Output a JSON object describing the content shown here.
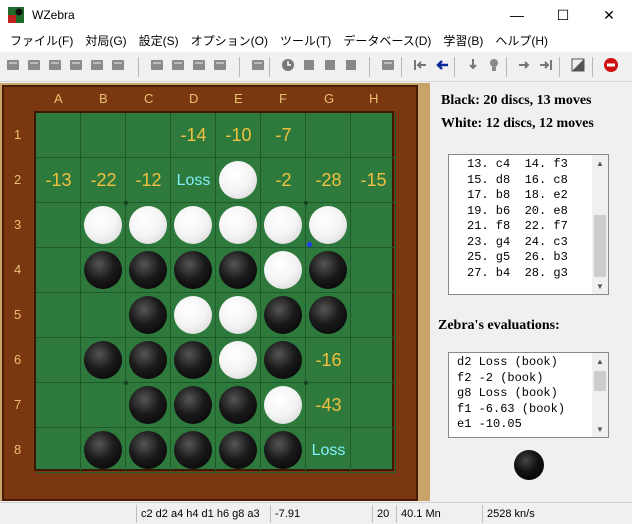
{
  "window": {
    "title": "WZebra",
    "minimize": "—",
    "maximize": "☐",
    "close": "✕"
  },
  "menu": [
    "ファイル(F)",
    "対局(G)",
    "設定(S)",
    "オプション(O)",
    "ツール(T)",
    "データベース(D)",
    "学習(B)",
    "ヘルプ(H)"
  ],
  "toolbar": [
    "new-board-icon",
    "open-icon",
    "save-icon",
    "print-icon",
    "copy-icon",
    "folder-icon",
    "export-icon",
    "book-icon",
    "book-edit-icon",
    "database-icon",
    "learn-icon",
    "clock-icon",
    "stop-icon",
    "pause-icon",
    "resign-icon",
    "step-icon",
    "undo-to-start-icon",
    "undo-icon",
    "redo-drop-icon",
    "hint-icon",
    "redo-icon",
    "redo-to-end-icon",
    "flip-board-icon",
    "quit-icon"
  ],
  "board": {
    "columns": [
      "A",
      "B",
      "C",
      "D",
      "E",
      "F",
      "G",
      "H"
    ],
    "rows": [
      "1",
      "2",
      "3",
      "4",
      "5",
      "6",
      "7",
      "8"
    ],
    "cells": [
      [
        "",
        "",
        "",
        "-14",
        "-10",
        "-7",
        "",
        ""
      ],
      [
        "-13",
        "-22",
        "-12",
        "Loss",
        "W",
        "-2",
        "-28",
        "-15"
      ],
      [
        "",
        "W",
        "W",
        "W",
        "W",
        "W",
        "W",
        ""
      ],
      [
        "",
        "B",
        "B",
        "B",
        "B",
        "W",
        "B",
        ""
      ],
      [
        "",
        "",
        "B",
        "W",
        "W",
        "B",
        "B",
        ""
      ],
      [
        "",
        "B",
        "B",
        "B",
        "W",
        "B",
        "-16",
        ""
      ],
      [
        "",
        "",
        "B",
        "B",
        "B",
        "W",
        "-43",
        ""
      ],
      [
        "",
        "B",
        "B",
        "B",
        "B",
        "B",
        "Loss",
        ""
      ]
    ]
  },
  "score": {
    "black": "Black:  20 discs, 13 moves",
    "white": "White:  12 discs, 12 moves"
  },
  "move_list": [
    "13. c4  14. f3",
    "15. d8  16. c8",
    "17. b8  18. e2",
    "19. b6  20. e8",
    "21. f8  22. f7",
    "23. g4  24. c3",
    "25. g5  26. b3",
    "27. b4  28. g3"
  ],
  "evaluations_heading": "Zebra's evaluations:",
  "evaluations": [
    "d2 Loss (book)",
    "f2 -2 (book)",
    "g8 Loss (book)",
    "f1 -6.63 (book)",
    "e1 -10.05"
  ],
  "status": {
    "line": "c2 d2 a4 h4 d1 h6 g8 a3",
    "eval": "-7.91",
    "depth": "20",
    "nodes": "40.1 Mn",
    "speed": "2528 kn/s"
  },
  "colors": {
    "board_green": "#2e7a3c",
    "eval_number": "#f0c040",
    "eval_loss": "#7ff0f8",
    "frame": "#7a3710"
  }
}
